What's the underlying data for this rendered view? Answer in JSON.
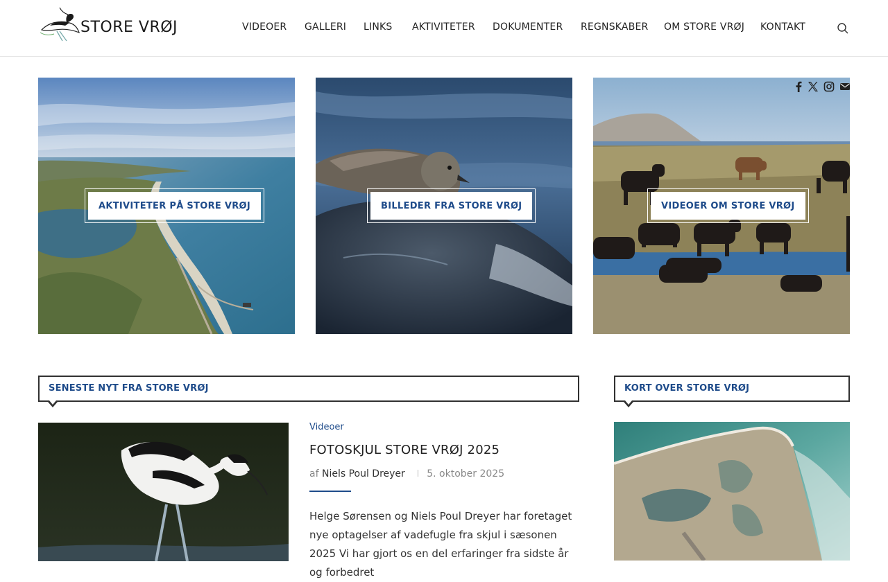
{
  "header": {
    "logo_text": "STORE VRØJ",
    "nav": [
      "VIDEOER",
      "GALLERI",
      "LINKS",
      "AKTIVITETER",
      "DOKUMENTER",
      "REGNSKABER",
      "OM STORE VRØJ",
      "KONTAKT"
    ]
  },
  "features": [
    {
      "label": "AKTIVITETER PÅ STORE VRØJ"
    },
    {
      "label": "BILLEDER FRA STORE VRØJ"
    },
    {
      "label": "VIDEOER OM STORE VRØJ"
    }
  ],
  "social": [
    "facebook-icon",
    "x-icon",
    "instagram-icon",
    "email-icon"
  ],
  "news": {
    "heading": "SENESTE NYT FRA STORE VRØJ",
    "post": {
      "category": "Videoer",
      "title": "FOTOSKJUL STORE VRØJ 2025",
      "by": "af",
      "author": "Niels Poul Dreyer",
      "date": "5. oktober 2025",
      "excerpt": "Helge Sørensen og Niels Poul Dreyer har foretaget nye optagelser af vadefugle fra skjul i sæsonen 2025 Vi har gjort os en del erfaringer fra sidste år og forbedret"
    }
  },
  "map": {
    "heading": "KORT OVER STORE VRØJ"
  },
  "colors": {
    "accent": "#1e4b8a",
    "border": "#313131"
  }
}
